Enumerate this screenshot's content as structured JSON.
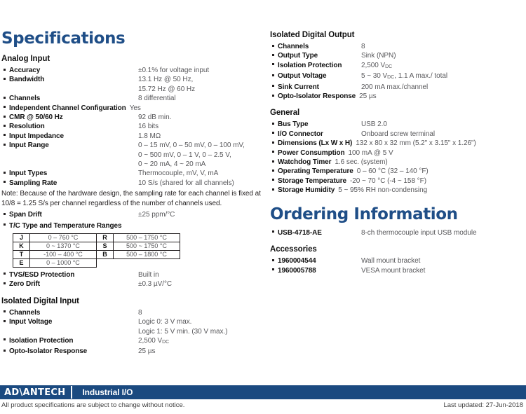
{
  "titles": {
    "specifications": "Specifications",
    "ordering": "Ordering Information"
  },
  "left_column": {
    "analog_input": {
      "heading": "Analog Input",
      "rows": [
        {
          "label": "Accuracy",
          "value": "±0.1% for voltage input"
        },
        {
          "label": "Bandwidth",
          "value": "13.1 Hz @ 50 Hz,\n15.72 Hz @ 60 Hz"
        },
        {
          "label": "Channels",
          "value": "8 differential"
        },
        {
          "label": "Independent Channel Configuration",
          "value": "Yes"
        },
        {
          "label": "CMR @ 50/60 Hz",
          "value": "92 dB min."
        },
        {
          "label": "Resolution",
          "value": "16 bits"
        },
        {
          "label": "Input Impedance",
          "value": "1.8 MΩ"
        },
        {
          "label": "Input Range",
          "value": "0 – 15 mV, 0 – 50 mV, 0 – 100 mV,\n0 ~ 500 mV, 0 – 1 V, 0 – 2.5 V,\n0 ~ 20 mA, 4 ~ 20 mA"
        },
        {
          "label": "Input Types",
          "value": "Thermocouple, mV, V, mA"
        },
        {
          "label": "Sampling Rate",
          "value": "10 S/s (shared for all channels)"
        }
      ],
      "note": "Note: Because of the hardware design, the sampling rate for each channel is fixed at 10/8 = 1.25 S/s per channel regardless of the number of channels used.",
      "rows_after_note": [
        {
          "label": "Span Drift",
          "value": "±25 ppm/°C"
        }
      ],
      "tc_label": "T/C Type and Temperature Ranges",
      "tc_table": [
        {
          "type_a": "J",
          "range_a": "0 – 760 °C",
          "type_b": "R",
          "range_b": "500 – 1750 °C"
        },
        {
          "type_a": "K",
          "range_a": "0 ~ 1370 °C",
          "type_b": "S",
          "range_b": "500 ~ 1750 °C"
        },
        {
          "type_a": "T",
          "range_a": "-100 – 400 °C",
          "type_b": "B",
          "range_b": "500 – 1800 °C"
        },
        {
          "type_a": "E",
          "range_a": "0 – 1000 °C",
          "type_b": "",
          "range_b": ""
        }
      ],
      "rows_after_table": [
        {
          "label": "TVS/ESD Protection",
          "value": "Built in"
        },
        {
          "label": "Zero Drift",
          "value": "±0.3 µV/°C"
        }
      ]
    },
    "isolated_digital_input": {
      "heading": "Isolated Digital Input",
      "rows": [
        {
          "label": "Channels",
          "value": "8"
        },
        {
          "label": "Input Voltage",
          "value": "Logic 0: 3 V max.\nLogic 1: 5 V min. (30 V max.)"
        },
        {
          "label": "Isolation Protection",
          "value": "2,500 V",
          "sub": "DC"
        },
        {
          "label": "Opto-Isolator Response",
          "value": "25 µs"
        }
      ]
    }
  },
  "right_column": {
    "isolated_digital_output": {
      "heading": "Isolated Digital Output",
      "rows": [
        {
          "label": "Channels",
          "value": "8"
        },
        {
          "label": "Output Type",
          "value": "Sink (NPN)"
        },
        {
          "label": "Isolation Protection",
          "value": "2,500 V",
          "sub": "DC"
        },
        {
          "label": "Output Voltage",
          "value": "5 ~ 30 V",
          "sub": "DC",
          "value_tail": ", 1.1 A max./ total"
        },
        {
          "label": "Sink Current",
          "value": "200 mA max./channel"
        },
        {
          "label": "Opto-Isolator Response",
          "value": "25 µs",
          "wide": true
        }
      ]
    },
    "general": {
      "heading": "General",
      "rows": [
        {
          "label": "Bus Type",
          "value": "USB 2.0"
        },
        {
          "label": "I/O Connector",
          "value": "Onboard screw terminal"
        },
        {
          "label": "Dimensions (Lx W x H)",
          "value": "132 x 80 x 32 mm (5.2\" x 3.15\" x 1.26\")",
          "wide": true
        },
        {
          "label": "Power Consumption",
          "value": "100 mA @ 5 V",
          "wide": true
        },
        {
          "label": "Watchdog Timer",
          "value": "1.6 sec. (system)",
          "wide": true
        },
        {
          "label": "Operating Temperature",
          "value": "0 – 60 °C (32 – 140 °F)",
          "wide": true
        },
        {
          "label": "Storage Temperature",
          "value": "-20 ~ 70 °C (-4 ~ 158 °F)",
          "wide": true
        },
        {
          "label": "Storage Humidity",
          "value": "5 ~ 95% RH non-condensing",
          "wide": true
        }
      ]
    },
    "ordering": {
      "rows": [
        {
          "label": "USB-4718-AE",
          "value": "8-ch thermocouple input USB module"
        }
      ]
    },
    "accessories": {
      "heading": "Accessories",
      "rows": [
        {
          "label": "1960004544",
          "value": "Wall mount bracket"
        },
        {
          "label": "1960005788",
          "value": "VESA mount bracket"
        }
      ]
    }
  },
  "footer": {
    "logo_pre": "AD",
    "logo_slash": "\\",
    "logo_post": "ANTECH",
    "bar_title": "Industrial I/O",
    "disclaimer": "All product specifications are subject to change without notice.",
    "last_updated": "Last updated: 27-Jun-2018"
  },
  "colors": {
    "title_blue": "#1f4e87",
    "footer_bar": "#1b4a80",
    "label_text": "#111111",
    "value_text": "#58585b"
  }
}
